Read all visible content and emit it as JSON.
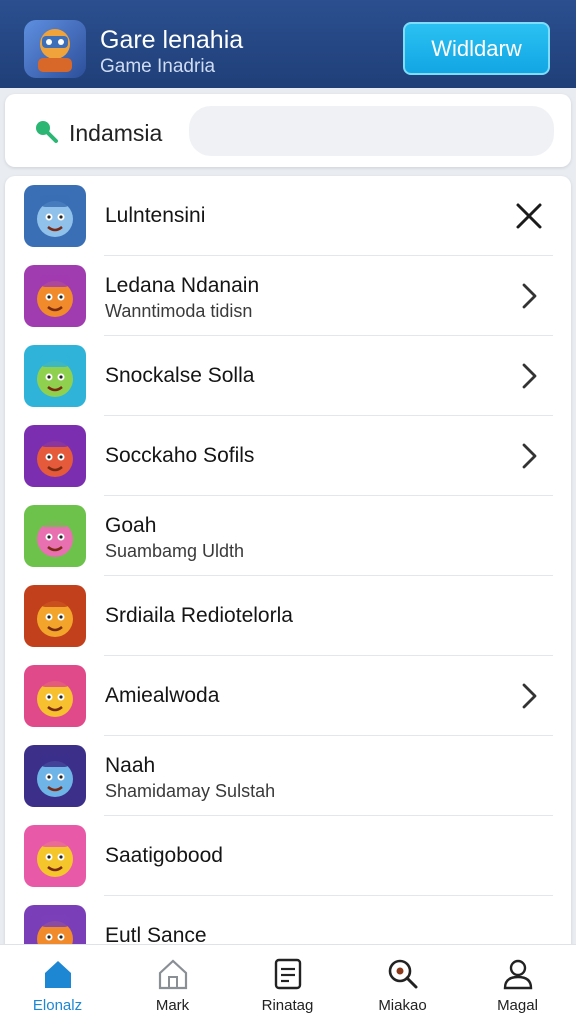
{
  "header": {
    "title": "Gare lenahia",
    "subtitle": "Game Inadria",
    "button_label": "Widldarw"
  },
  "search": {
    "label": "Indamsia",
    "placeholder": ""
  },
  "list": {
    "items": [
      {
        "title": "Lulntensini",
        "subtitle": "",
        "action": "close-icon",
        "icon_colors": [
          "#3a6fb5",
          "#8fc1ea"
        ]
      },
      {
        "title": "Ledana Ndanain",
        "subtitle": "Wanntimoda tidisn",
        "action": "chevron-right-icon",
        "icon_colors": [
          "#a13bb0",
          "#f08a2a"
        ]
      },
      {
        "title": "Snockalse Solla",
        "subtitle": "",
        "action": "chevron-right-icon",
        "icon_colors": [
          "#2fb3d8",
          "#8fd14f"
        ]
      },
      {
        "title": "Socckaho Sofils",
        "subtitle": "",
        "action": "chevron-right-icon",
        "icon_colors": [
          "#7b2fb0",
          "#e45a3a"
        ]
      },
      {
        "title": "Goah",
        "subtitle": "Suambamg Uldth",
        "action": "",
        "icon_colors": [
          "#6cc24a",
          "#e86fb0"
        ]
      },
      {
        "title": "Srdiaila Rediotelorla",
        "subtitle": "",
        "action": "",
        "icon_colors": [
          "#c2411c",
          "#f2a52a"
        ]
      },
      {
        "title": "Amiealwoda",
        "subtitle": "",
        "action": "chevron-right-icon",
        "icon_colors": [
          "#e04a8a",
          "#f6c02e"
        ]
      },
      {
        "title": "Naah",
        "subtitle": "Shamidamay Sulstah",
        "action": "",
        "icon_colors": [
          "#3b2f8a",
          "#6fb4e6"
        ]
      },
      {
        "title": "Saatigobood",
        "subtitle": "",
        "action": "",
        "icon_colors": [
          "#e85aa8",
          "#f5c62c"
        ]
      },
      {
        "title": "Eutl Sance",
        "subtitle": "",
        "action": "",
        "icon_colors": [
          "#7a3fb8",
          "#f08a2a"
        ]
      }
    ]
  },
  "nav": {
    "items": [
      {
        "label": "Elonalz",
        "icon": "home-icon",
        "active": true
      },
      {
        "label": "Mark",
        "icon": "house-outline-icon",
        "active": false
      },
      {
        "label": "Rinatag",
        "icon": "document-icon",
        "active": false
      },
      {
        "label": "Miakao",
        "icon": "search-icon",
        "active": false
      },
      {
        "label": "Magal",
        "icon": "profile-icon",
        "active": false
      }
    ]
  },
  "colors": {
    "header_bg": "#243f7a",
    "accent": "#1ea8e6",
    "nav_active": "#1e87d4",
    "search_icon": "#2bb673"
  }
}
